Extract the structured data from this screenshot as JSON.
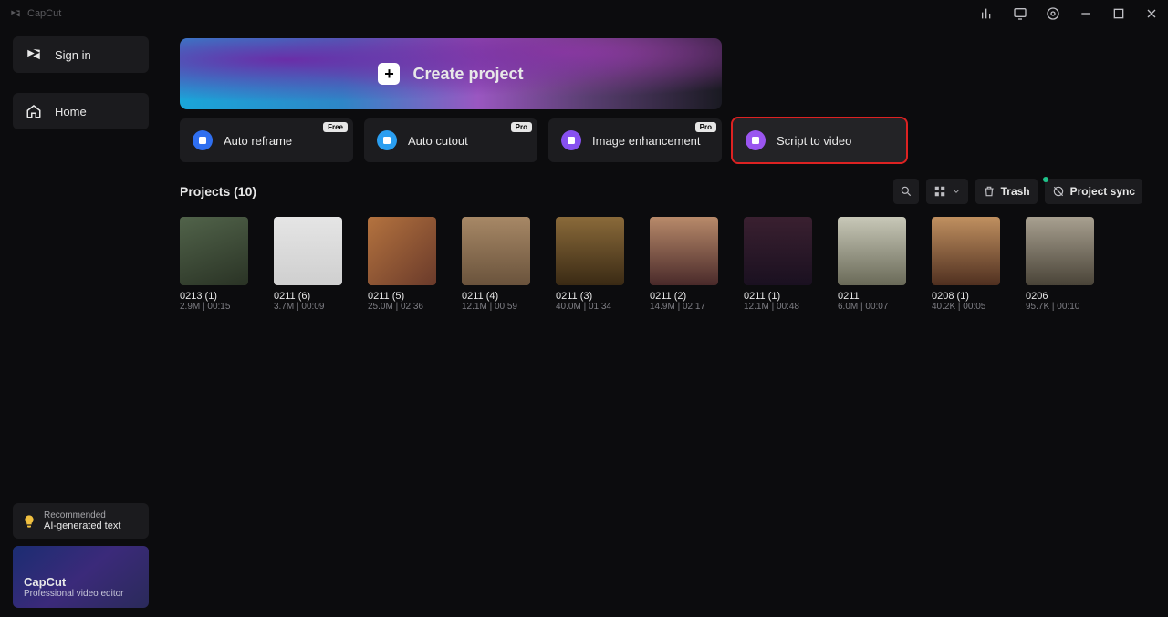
{
  "app": {
    "name": "CapCut"
  },
  "titlebar": {
    "icons": [
      "stats-icon",
      "feedback-icon",
      "settings-icon",
      "minimize-icon",
      "maximize-icon",
      "close-icon"
    ]
  },
  "sidebar": {
    "signin_label": "Sign in",
    "home_label": "Home"
  },
  "recommended": {
    "tag": "Recommended",
    "text": "AI-generated text"
  },
  "promo": {
    "title": "CapCut",
    "subtitle": "Professional video editor"
  },
  "create": {
    "label": "Create project"
  },
  "features": [
    {
      "label": "Auto reframe",
      "badge": "Free",
      "icon": "reframe-icon",
      "color": "fi-blue"
    },
    {
      "label": "Auto cutout",
      "badge": "Pro",
      "icon": "cutout-icon",
      "color": "fi-cyan"
    },
    {
      "label": "Image enhancement",
      "badge": "Pro",
      "icon": "enhance-icon",
      "color": "fi-purple"
    },
    {
      "label": "Script to video",
      "badge": "",
      "icon": "script-icon",
      "color": "fi-violet",
      "highlight": true
    }
  ],
  "projects_header": "Projects  (10)",
  "toolbar": {
    "trash": "Trash",
    "sync": "Project sync"
  },
  "projects": [
    {
      "name": "0213 (1)",
      "meta": "2.9M | 00:15"
    },
    {
      "name": "0211 (6)",
      "meta": "3.7M | 00:09"
    },
    {
      "name": "0211 (5)",
      "meta": "25.0M | 02:36"
    },
    {
      "name": "0211 (4)",
      "meta": "12.1M | 00:59"
    },
    {
      "name": "0211 (3)",
      "meta": "40.0M | 01:34"
    },
    {
      "name": "0211 (2)",
      "meta": "14.9M | 02:17"
    },
    {
      "name": "0211 (1)",
      "meta": "12.1M | 00:48"
    },
    {
      "name": "0211",
      "meta": "6.0M | 00:07"
    },
    {
      "name": "0208 (1)",
      "meta": "40.2K | 00:05"
    },
    {
      "name": "0206",
      "meta": "95.7K | 00:10"
    }
  ]
}
